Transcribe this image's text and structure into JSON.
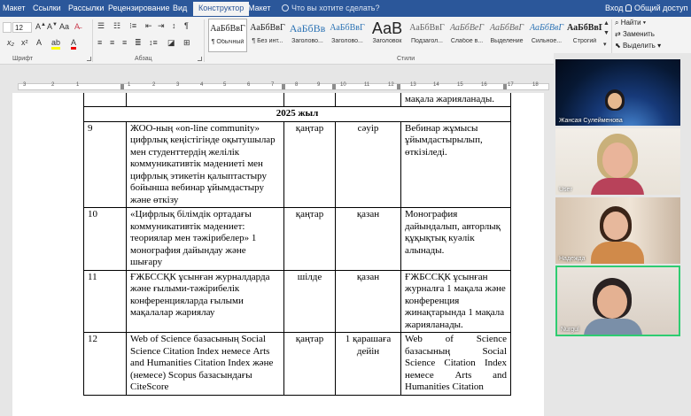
{
  "tabs": [
    "Макет",
    "Ссылки",
    "Рассылки",
    "Рецензирование",
    "Вид",
    "Конструктор",
    "Макет"
  ],
  "active_tab_index": 5,
  "tell_me": "Что вы хотите сделать?",
  "account": {
    "login": "Вход",
    "share": "Общий доступ"
  },
  "font": {
    "size": "12"
  },
  "groups": {
    "font": "Шрифт",
    "paragraph": "Абзац",
    "styles": "Стили"
  },
  "styles": [
    {
      "sample": "АаБбВвГ",
      "name": "¶ Обычный"
    },
    {
      "sample": "АаБбВвГ",
      "name": "¶ Без инт..."
    },
    {
      "sample": "АаБбВв",
      "name": "Заголово..."
    },
    {
      "sample": "АаБбВвГ",
      "name": "Заголово..."
    },
    {
      "sample": "АаВ",
      "name": "Заголовок"
    },
    {
      "sample": "АаБбВвГ",
      "name": "Подзагол..."
    },
    {
      "sample": "АаБбВеГ",
      "name": "Слабое в..."
    },
    {
      "sample": "АаБбВвГ",
      "name": "Выделение"
    },
    {
      "sample": "АаБбВвГ",
      "name": "Сильное..."
    },
    {
      "sample": "АаБбВвГ",
      "name": "Строгий"
    }
  ],
  "editing": {
    "find": "Найти",
    "replace": "Заменить",
    "select": "Выделить"
  },
  "ruler_numbers": [
    "3",
    "2",
    "1",
    "1",
    "2",
    "3",
    "4",
    "5",
    "6",
    "7",
    "8",
    "9",
    "10",
    "11",
    "12",
    "13",
    "14",
    "15",
    "16",
    "17",
    "18"
  ],
  "table": {
    "top_row_text": "мақала жарияланады.",
    "year_row": "2025 жыл",
    "rows": [
      {
        "num": "9",
        "title": "ЖОО-ның «on-line community» цифрлық кеңістігінде оқытушылар мен студенттердің желілік коммуникативтік мәдениеті мен цифрлық этикетін қалыптастыру бойынша вебинар ұйымдастыру және өткізу",
        "start": "қаңтар",
        "end": "сәуір",
        "result": "Вебинар жұмысы ұйымдастырылып, өткізіледі."
      },
      {
        "num": "10",
        "title": "«Цифрлық білімдік ортадағы коммуникативтік мәдениет: теориялар мен тәжірибелер» 1 монография дайындау және шығару",
        "start": "қаңтар",
        "end": "қазан",
        "result": "Монография дайындалып, авторлық құқықтық куәлік алынады."
      },
      {
        "num": "11",
        "title": "ҒЖБССҚК ұсынған журналдарда және ғылыми-тәжірибелік конференцияларда ғылыми мақалалар жариялау",
        "start": "шілде",
        "end": "қазан",
        "result": "ҒЖБССҚК ұсынған журналға 1 мақала және конференция жинақтарында 1 мақала жарияланады."
      },
      {
        "num": "12",
        "title": "Web of Science базасының Social Science Citation Index немесе Arts and Humanities Citation Index және (немесе) Scopus базасындағы CiteScore",
        "start": "қаңтар",
        "end": "1 қарашаға дейін",
        "result": "Web of Science базасының Social Science Citation Index немесе Arts and Humanities Citation"
      }
    ]
  },
  "participants": [
    {
      "name": "Жансая Сулейменова"
    },
    {
      "name": "User"
    },
    {
      "name": "Надежда"
    },
    {
      "name": "Nurgul"
    }
  ],
  "colors": {
    "ribbon_blue": "#2b579a",
    "speaking_border": "#2ecc71"
  }
}
